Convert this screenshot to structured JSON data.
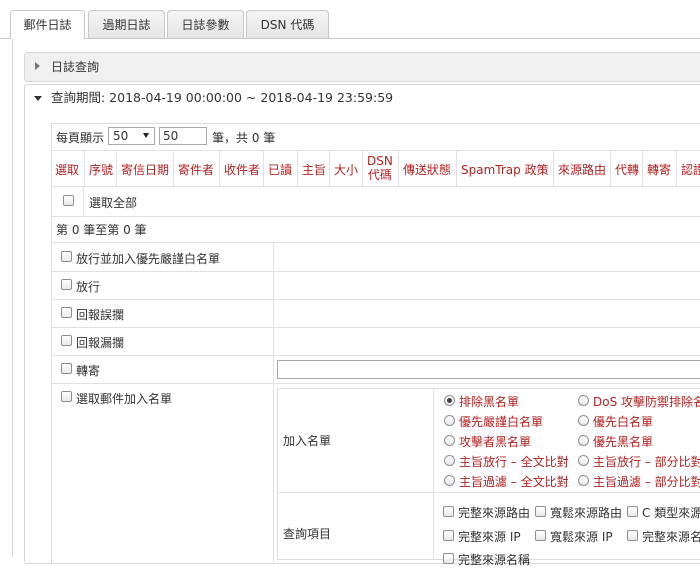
{
  "tabs": [
    "郵件日誌",
    "過期日誌",
    "日誌參數",
    "DSN 代碼"
  ],
  "log_query_section": "日誌查詢",
  "query_period": "查詢期間: 2018-04-19 00:00:00 ~ 2018-04-19 23:59:59",
  "pager": {
    "per_page_label": "每頁顯示",
    "per_page_value": "50",
    "per_page_input": "50",
    "total_text": "筆，共 0 筆"
  },
  "columns": [
    "選取",
    "序號",
    "寄信日期",
    "寄件者",
    "收件者",
    "已讀",
    "主旨",
    "大小",
    "DSN\n代碼",
    "傳送狀態",
    "SpamTrap 政策",
    "來源路由",
    "代轉",
    "轉寄",
    "認證"
  ],
  "select_all": "選取全部",
  "range_text": "第 0 筆至第 0 筆",
  "actions": [
    "放行並加入優先嚴謹白名單",
    "放行",
    "回報誤攔",
    "回報漏攔",
    "轉寄",
    "選取郵件加入名單"
  ],
  "add_list": {
    "label": "加入名單",
    "options_left": [
      "排除黑名單",
      "優先嚴謹白名單",
      "攻擊者黑名單",
      "主旨放行 – 全文比對",
      "主旨過濾 – 全文比對"
    ],
    "options_right": [
      "DoS 攻擊防禦排除名",
      "優先白名單",
      "優先黑名單",
      "主旨放行 – 部分比對",
      "主旨過濾 – 部分比對"
    ],
    "selected": "排除黑名單"
  },
  "query_items": {
    "label": "查詢項目",
    "row1": [
      "完整來源路由",
      "寬鬆來源路由",
      "C 類型來源"
    ],
    "row2": [
      "完整來源 IP",
      "寬鬆來源 IP",
      "完整來源名"
    ],
    "row3": [
      "完整來源名稱"
    ]
  },
  "colors": {
    "header_red": "#b22222",
    "border": "#dcdcdc"
  }
}
